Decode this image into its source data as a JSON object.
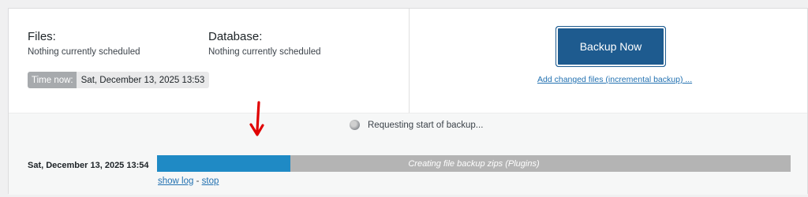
{
  "schedule": {
    "files_title": "Files:",
    "files_status": "Nothing currently scheduled",
    "database_title": "Database:",
    "database_status": "Nothing currently scheduled"
  },
  "time_now": {
    "label": "Time now:",
    "value": "Sat, December 13, 2025 13:53"
  },
  "actions": {
    "backup_now_label": "Backup Now",
    "incremental_link": "Add changed files (incremental backup) ..."
  },
  "job": {
    "status_text": "Requesting start of backup...",
    "date": "Sat, December 13, 2025 13:54",
    "progress_percent": 21,
    "progress_text": "Creating file backup zips (Plugins)",
    "show_log_label": "show log",
    "separator": " - ",
    "stop_label": "stop"
  },
  "colors": {
    "accent": "#1e5b8f",
    "progress_fill": "#1f8ac5",
    "progress_track": "#b4b4b4",
    "annotation_arrow": "#e00000"
  }
}
